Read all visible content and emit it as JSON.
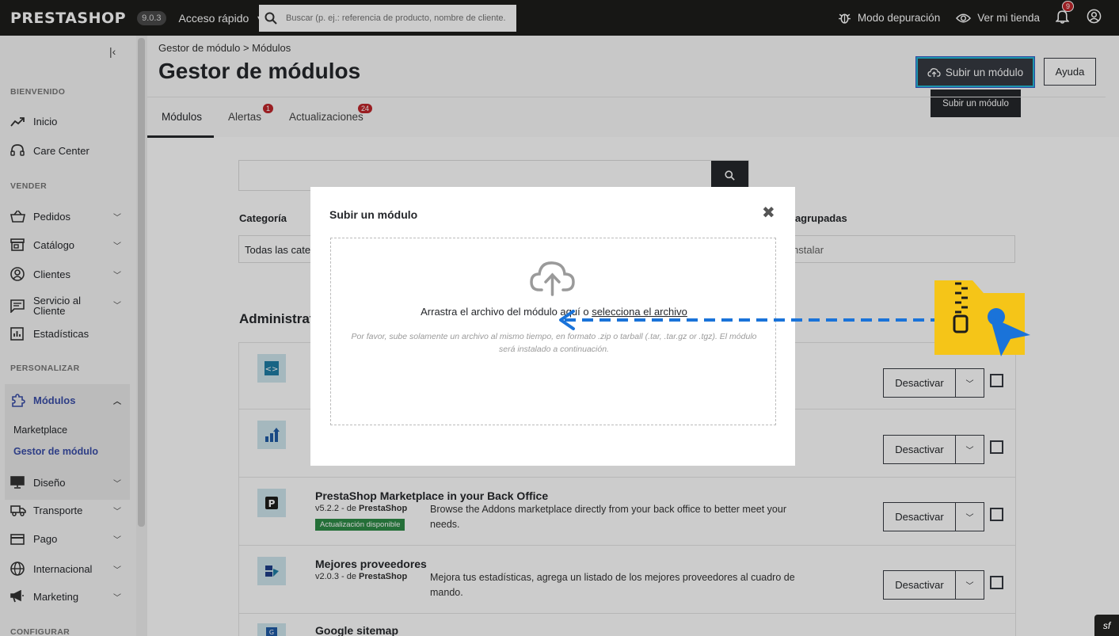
{
  "topbar": {
    "logo": "PRESTASHOP",
    "version": "9.0.3",
    "quick_access": "Acceso rápido",
    "search_placeholder": "Buscar (p. ej.: referencia de producto, nombre de cliente.",
    "debug_mode": "Modo depuración",
    "view_shop": "Ver mi tienda",
    "notifications_count": "9"
  },
  "sidebar": {
    "sections": {
      "welcome": "BIENVENIDO",
      "sell": "VENDER",
      "customize": "PERSONALIZAR",
      "configure": "CONFIGURAR"
    },
    "items": {
      "home": "Inicio",
      "care_center": "Care Center",
      "orders": "Pedidos",
      "catalog": "Catálogo",
      "customers": "Clientes",
      "customer_service": "Servicio al Cliente",
      "stats": "Estadísticas",
      "modules": "Módulos",
      "marketplace": "Marketplace",
      "module_manager": "Gestor de módulo",
      "design": "Diseño",
      "shipping": "Transporte",
      "payment": "Pago",
      "international": "Internacional",
      "marketing": "Marketing"
    }
  },
  "header": {
    "breadcrumb": "Gestor de módulo  >  Módulos",
    "title": "Gestor de módulos",
    "upload_button": "Subir un módulo",
    "help_button": "Ayuda",
    "tooltip": "Subir un módulo"
  },
  "tabs": {
    "modules": "Módulos",
    "alerts": "Alertas",
    "alerts_count": "1",
    "updates": "Actualizaciones",
    "updates_count": "24"
  },
  "filters": {
    "category_label": "Categoría",
    "category_value": "Todas las categ",
    "group_label": "ones agrupadas",
    "group_value": "nstalar"
  },
  "section_heading": "Administrat",
  "modules": [
    {
      "name": "",
      "version": "",
      "description": "",
      "action": "Desactivar"
    },
    {
      "name": "",
      "version": "",
      "description": "",
      "action": "Desactivar"
    },
    {
      "name": "PrestaShop Marketplace in your Back Office",
      "version": "v5.2.2 - de ",
      "author": "PrestaShop",
      "badge": "Actualización disponible",
      "description": "Browse the Addons marketplace directly from your back office to better meet your needs.",
      "action": "Desactivar"
    },
    {
      "name": "Mejores proveedores",
      "version": "v2.0.3 - de ",
      "author": "PrestaShop",
      "description": "Mejora tus estadísticas, agrega un listado de los mejores proveedores al cuadro de mando.",
      "action": "Desactivar"
    },
    {
      "name": "Google sitemap"
    }
  ],
  "modal": {
    "title": "Subir un módulo",
    "close": "✖",
    "drop_text": "Arrastra el archivo del módulo aquí o ",
    "select_link": "selecciona el archivo",
    "hint": "Por favor, sube solamente un archivo al mismo tiempo, en formato .zip o tarball (.tar, .tar.gz or .tgz). El módulo será instalado a continuación."
  },
  "colors": {
    "topbar": "#1d1d1b",
    "accent_border": "#25b9d7",
    "badge_red": "#c0262b",
    "update_badge": "#2e8b46",
    "annotation_blue": "#1a73d9",
    "zip_folder": "#f5c518"
  }
}
